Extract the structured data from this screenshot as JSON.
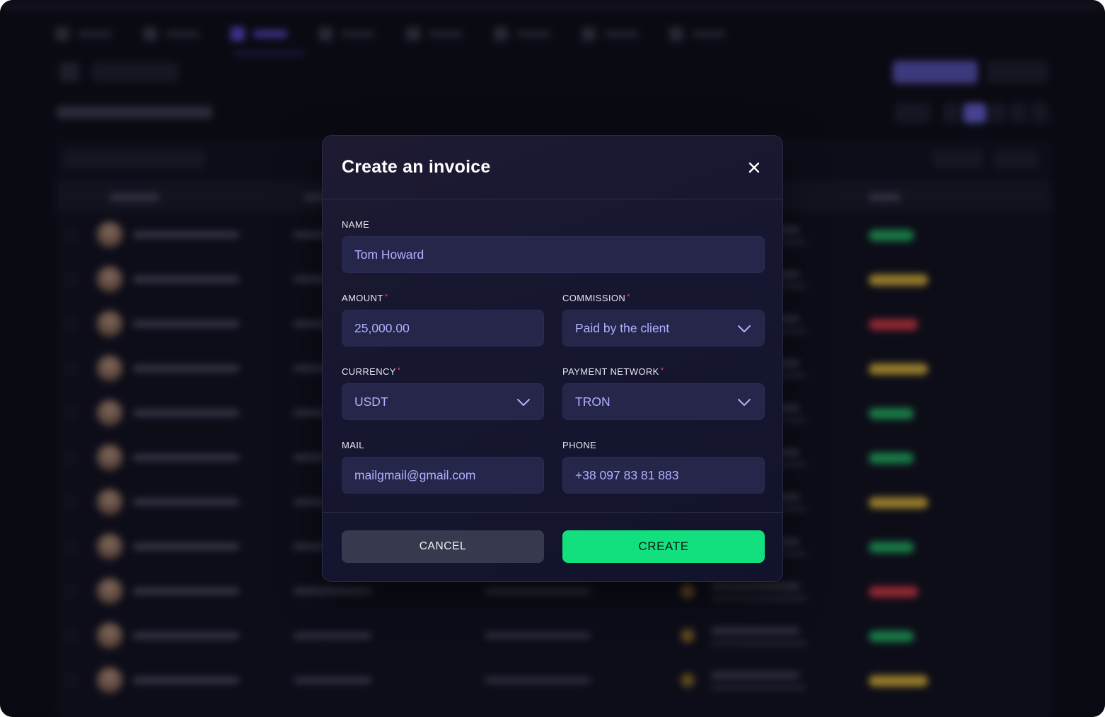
{
  "modal": {
    "title": "Create an invoice",
    "fields": {
      "name": {
        "label": "NAME",
        "value": "Tom Howard",
        "required": false
      },
      "amount": {
        "label": "AMOUNT",
        "value": "25,000.00",
        "required": true
      },
      "commission": {
        "label": "COMMISSION",
        "value": "Paid by the client",
        "required": true
      },
      "currency": {
        "label": "CURRENCY",
        "value": "USDT",
        "required": true
      },
      "payment_network": {
        "label": "PAYMENT NETWORK",
        "value": "TRON",
        "required": true
      },
      "mail": {
        "label": "MAIL",
        "value": "mailgmail@gmail.com",
        "required": false
      },
      "phone": {
        "label": "PHONE",
        "value": "+38 097 83 81 883",
        "required": false
      }
    },
    "required_marker": "*",
    "buttons": {
      "cancel": "CANCEL",
      "create": "CREATE"
    }
  },
  "icons": {
    "close": "close-icon",
    "dropdown": "chevron-down-icon"
  },
  "colors": {
    "accent_green": "#12e07f",
    "input_text": "#b2b1ff",
    "required": "#ff3a55",
    "modal_bg": "#161630",
    "status_green": "#22b864",
    "status_yellow": "#e2b93b",
    "status_red": "#d83a47"
  },
  "background_table": {
    "status_colors": [
      "green",
      "yellow",
      "red",
      "yellow",
      "green",
      "green",
      "yellow",
      "green",
      "red",
      "green",
      "yellow"
    ]
  }
}
